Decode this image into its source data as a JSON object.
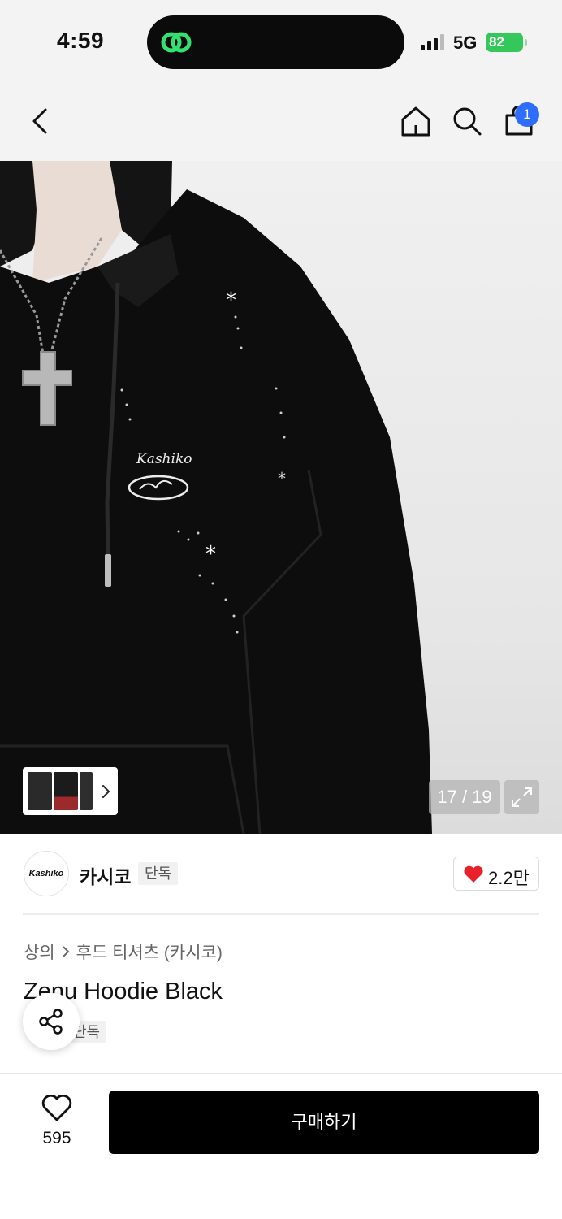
{
  "status_bar": {
    "time": "4:59",
    "network": "5G",
    "battery": "82"
  },
  "nav": {
    "cart_count": "1",
    "icons": [
      "back-chevron-icon",
      "home-icon",
      "search-icon",
      "shopping-bag-icon"
    ]
  },
  "gallery": {
    "counter": "17 / 19",
    "thumbnail_more_icon": "chevron-right-icon",
    "expand_icon": "expand-arrows-icon",
    "image_text": {
      "brand_wordmark": "Kashiko"
    }
  },
  "brand": {
    "logo_text": "Kashiko",
    "name": "카시코",
    "tag": "단독",
    "likes": "2.2만",
    "like_color": "#e8202a"
  },
  "product": {
    "breadcrumb": [
      "상의",
      "후드 티셔츠 (카시코)"
    ],
    "title": "Zenu Hoodie Black",
    "tag": "단독"
  },
  "bottom_bar": {
    "wish_count": "595",
    "buy_label": "구매하기"
  },
  "colors": {
    "accent_badge": "#2f6dff",
    "battery": "#34c759",
    "buy_button": "#000000"
  }
}
